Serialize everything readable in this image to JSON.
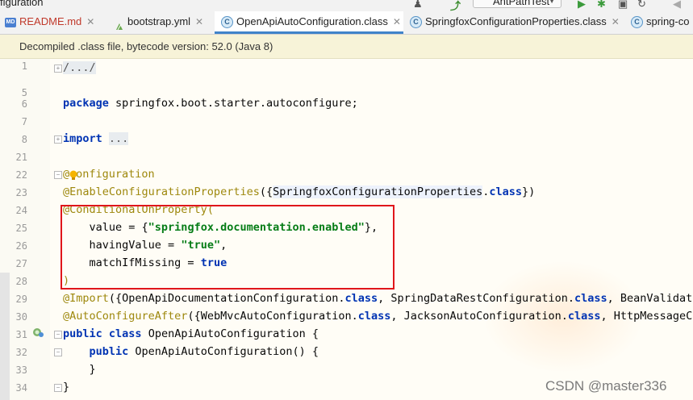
{
  "window": {
    "project_title_fragment": "figuration",
    "run_config": "AntPathTest"
  },
  "tabs": [
    {
      "label": "README.md",
      "icon": "markdown-icon"
    },
    {
      "label": "bootstrap.yml",
      "icon": "yaml-icon"
    },
    {
      "label": "OpenApiAutoConfiguration.class",
      "icon": "class-icon",
      "active": true
    },
    {
      "label": "SpringfoxConfigurationProperties.class",
      "icon": "class-icon"
    },
    {
      "label": "spring-co",
      "icon": "class-icon"
    }
  ],
  "banner": "Decompiled .class file, bytecode version: 52.0 (Java 8)",
  "line_numbers": [
    "1",
    "5",
    "6",
    "7",
    "8",
    "21",
    "22",
    "23",
    "24",
    "25",
    "26",
    "27",
    "28",
    "29",
    "30",
    "31",
    "32",
    "33",
    "34"
  ],
  "code": {
    "l1": "/.../",
    "l6_kw": "package",
    "l6_rest": " springfox.boot.starter.autoconfigure;",
    "l8_kw": "import",
    "l8_fold": "...",
    "l22_at": "@",
    "l22_rest": "onfiguration",
    "l23_ann": "@EnableConfigurationProperties",
    "l23_open": "({",
    "l23_cls": "SpringfoxConfigurationProperties",
    "l23_dot": ".",
    "l23_kw": "class",
    "l23_close": "})",
    "l24_ann": "@ConditionalOnProperty",
    "l24_rest": "(",
    "l25_pre": "    value = {",
    "l25_str": "\"springfox.documentation.enabled\"",
    "l25_post": "},",
    "l26_pre": "    havingValue = ",
    "l26_str": "\"true\"",
    "l26_post": ",",
    "l27_pre": "    matchIfMissing = ",
    "l27_kw": "true",
    "l28": ")",
    "l29_ann": "@Import",
    "l29_a": "({OpenApiDocumentationConfiguration.",
    "l29_kw1": "class",
    "l29_b": ", SpringDataRestConfiguration.",
    "l29_kw2": "class",
    "l29_c": ", BeanValidator",
    "l30_ann": "@AutoConfigureAfter",
    "l30_a": "({WebMvcAutoConfiguration.",
    "l30_kw1": "class",
    "l30_b": ", JacksonAutoConfiguration.",
    "l30_kw2": "class",
    "l30_c": ", HttpMessageCon",
    "l31_kw1": "public",
    "l31_kw2": "class",
    "l31_rest": " OpenApiAutoConfiguration {",
    "l32_kw": "public",
    "l32_rest": " OpenApiAutoConfiguration() {",
    "l33": "    }",
    "l34": "}"
  },
  "watermark": "CSDN @master336",
  "colors": {
    "keyword": "#0033b3",
    "annotation": "#9e880d",
    "string": "#067d17",
    "highlight_box": "#e0161b",
    "active_tab_underline": "#4083c9"
  }
}
